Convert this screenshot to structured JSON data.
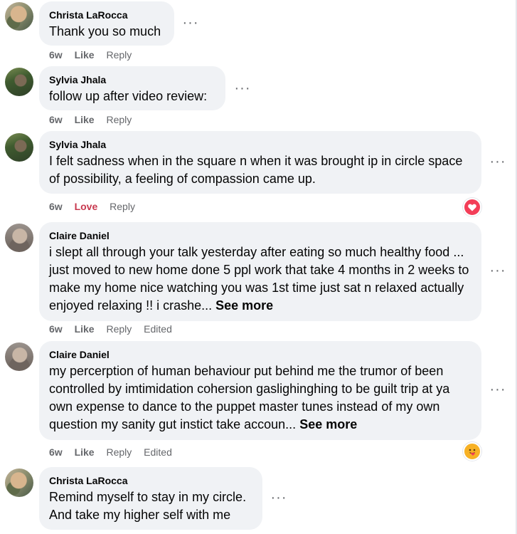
{
  "comments": [
    {
      "author": "Christa LaRocca",
      "text": "Thank you so much",
      "see_more": "",
      "time": "6w",
      "like": "Like",
      "reply": "Reply",
      "edited": ""
    },
    {
      "author": "Sylvia Jhala",
      "text": "follow up after video review:",
      "see_more": "",
      "time": "6w",
      "like": "Like",
      "reply": "Reply",
      "edited": ""
    },
    {
      "author": "Sylvia Jhala",
      "text": "I felt sadness when in the square n when it was brought ip in circle space of possibility, a feeling of compassion came up.",
      "see_more": "",
      "time": "6w",
      "like": "Love",
      "reply": "Reply",
      "edited": "",
      "reaction": "love-icon"
    },
    {
      "author": "Claire Daniel",
      "text": "i slept all through your talk yesterday after eating so much healthy food ... just moved to new home done 5 ppl work that take 4 months in 2 weeks to make my home nice watching you was 1st time just sat n relaxed actually enjoyed relaxing !! i crashe...",
      "see_more": "See more",
      "time": "6w",
      "like": "Like",
      "reply": "Reply",
      "edited": "Edited"
    },
    {
      "author": "Claire Daniel",
      "text": "my percerption of human behaviour put behind me the trumor of been controlled by imtimidation cohersion gaslighinghing to be guilt trip at ya own expense to dance to the puppet master tunes instead of my own question my sanity gut instict take accoun...",
      "see_more": "See more",
      "time": "6w",
      "like": "Like",
      "reply": "Reply",
      "edited": "Edited",
      "reaction": "care-icon"
    },
    {
      "author": "Christa LaRocca",
      "text": "Remind myself to stay in my circle. And take my higher self with me",
      "see_more": "",
      "time": "",
      "like": "",
      "reply": "",
      "edited": ""
    }
  ],
  "more_dots": "···",
  "colors": {
    "bubble": "#f0f2f5",
    "meta": "#65676b",
    "love": "#c8384e"
  }
}
